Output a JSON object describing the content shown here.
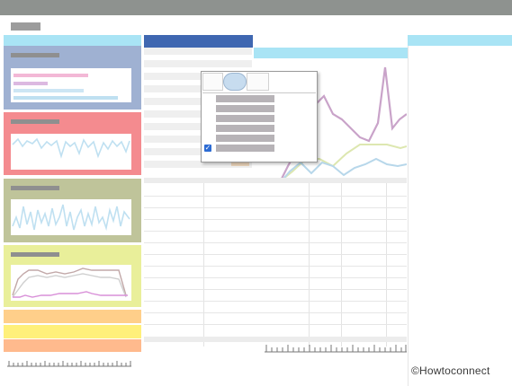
{
  "watermark": {
    "text": "©Howtoconnect"
  },
  "popup": {
    "checkbox_checked": true,
    "item_count": 6
  },
  "colors": {
    "accent_blue": "#3f67b1",
    "light_blue": "#a9e4f5",
    "card_lavender": "#9fb1d2",
    "card_pink": "#f48b8f",
    "card_olive": "#bfc49a",
    "card_yellow": "#e9ef9a",
    "strip_orange": "#ffcf8a",
    "strip_yellow": "#fff07a",
    "strip_peach": "#ffba8d"
  }
}
